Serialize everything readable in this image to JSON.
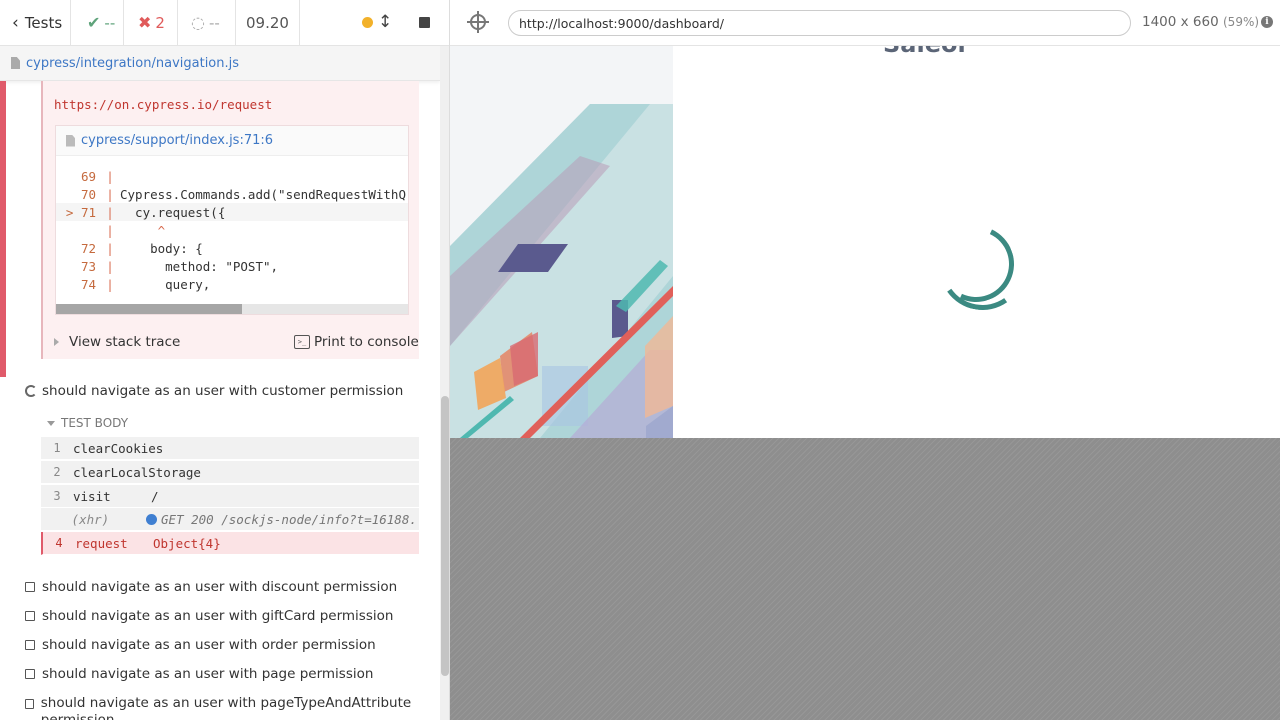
{
  "stats": {
    "tests_label": "Tests",
    "passed": "--",
    "failed": "2",
    "pending": "--",
    "duration": "09.20"
  },
  "spec": {
    "path": "cypress/integration/navigation.js"
  },
  "error": {
    "url": "https://on.cypress.io/request",
    "code_file": "cypress/support/index.js:71:6",
    "code_lines": [
      {
        "ln": "69",
        "mark": "|",
        "code": ""
      },
      {
        "ln": "70",
        "mark": "|",
        "code": "Cypress.Commands.add(\"sendRequestWithQ"
      },
      {
        "ln": "> 71",
        "mark": "|",
        "code": "  cy.request({"
      },
      {
        "ln": "",
        "mark": "|",
        "code": "     ^"
      },
      {
        "ln": "72",
        "mark": "|",
        "code": "    body: {"
      },
      {
        "ln": "73",
        "mark": "|",
        "code": "      method: \"POST\","
      },
      {
        "ln": "74",
        "mark": "|",
        "code": "      query,"
      }
    ],
    "view_stack_trace": "View stack trace",
    "print_to_console": "Print to console"
  },
  "current_test": {
    "title": "should navigate as an user with customer permission",
    "section_label": "TEST BODY",
    "commands": [
      {
        "num": "1",
        "name": "clearCookies",
        "msg": ""
      },
      {
        "num": "2",
        "name": "clearLocalStorage",
        "msg": ""
      },
      {
        "num": "3",
        "name": "visit",
        "msg": "/"
      },
      {
        "num": "",
        "name": "(xhr)",
        "msg": "GET 200 /sockjs-node/info?t=16188..."
      },
      {
        "num": "4",
        "name": "request",
        "msg": "Object{4}"
      }
    ]
  },
  "pending_tests": [
    "should navigate as an user with discount permission",
    "should navigate as an user with giftCard permission",
    "should navigate as an user with order permission",
    "should navigate as an user with page permission",
    "should navigate as an user with pageTypeAndAttribute permission"
  ],
  "aut": {
    "url": "http://localhost:9000/dashboard/",
    "viewport": "1400 x 660",
    "scale": "(59%)",
    "heading_fragment": "Saleor"
  },
  "colors": {
    "pass": "#5fa37b",
    "fail": "#e05a5a",
    "running": "#f2b12a",
    "loader": "#3b8a82",
    "link": "#3d77c5"
  }
}
